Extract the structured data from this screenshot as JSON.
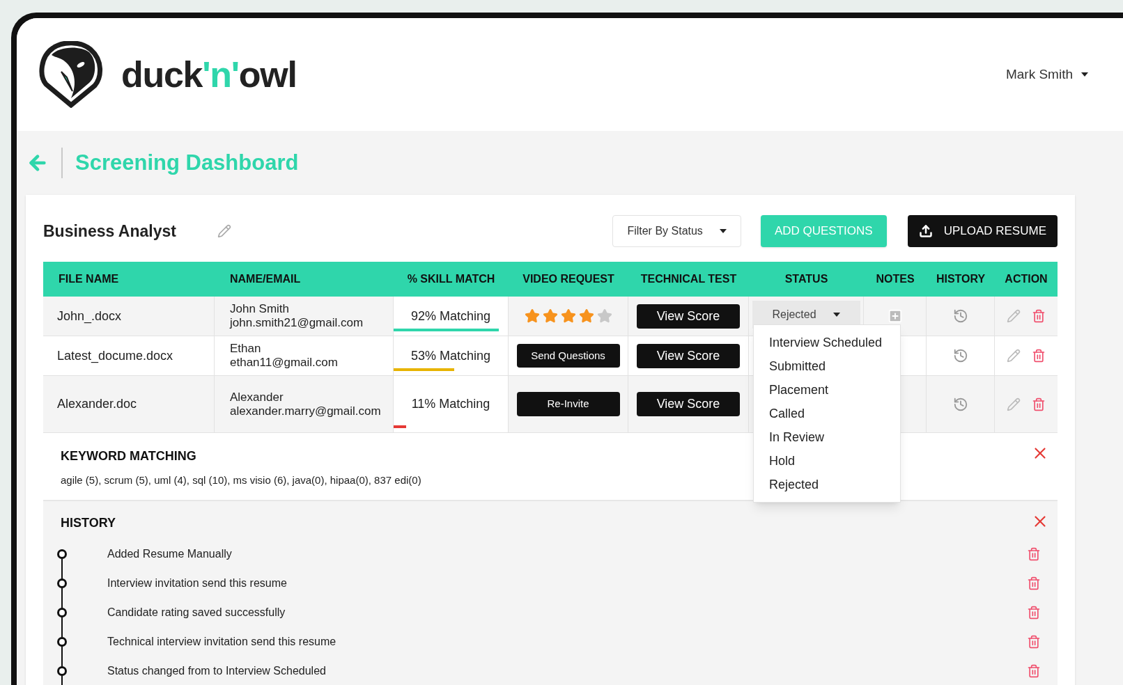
{
  "brand": {
    "parts": [
      {
        "text": "duck",
        "accent": false
      },
      {
        "text": "'n'",
        "accent": true
      },
      {
        "text": "owl",
        "accent": false
      }
    ]
  },
  "user": {
    "name": "Mark Smith"
  },
  "page_title": "Screening Dashboard",
  "job": {
    "title": "Business Analyst",
    "filter": "Filter By Status",
    "add_button": "ADD QUESTIONS",
    "upload_button": "UPLOAD RESUME"
  },
  "table": {
    "columns": [
      "FILE NAME",
      "NAME/EMAIL",
      "% SKILL MATCH",
      "VIDEO REQUEST",
      "TECHNICAL TEST",
      "STATUS",
      "NOTES",
      "HISTORY",
      "ACTION"
    ],
    "rows": [
      {
        "file": "John_.docx",
        "name": "John Smith",
        "email": "john.smith21@gmail.com",
        "match": "92% Matching",
        "level": 0.92,
        "color": "#2fd6ab",
        "video": {
          "kind": "stars",
          "stars": 4
        },
        "test": "View Score",
        "status": "Rejected",
        "notes": true
      },
      {
        "file": "Latest_docume.docx",
        "name": "Ethan",
        "email": "ethan11@gmail.com",
        "match": "53% Matching",
        "level": 0.53,
        "color": "#e8b400",
        "video": {
          "kind": "button",
          "label": "Send Questions"
        },
        "test": "View Score"
      },
      {
        "file": "Alexander.doc",
        "name": "Alexander",
        "email": "alexander.marry@gmail.com",
        "match": "11% Matching",
        "level": 0.11,
        "color": "#e53935",
        "video": {
          "kind": "button",
          "label": "Re-Invite"
        },
        "test": "View Score"
      }
    ]
  },
  "status_menu": [
    "Interview Scheduled",
    "Submitted",
    "Placement",
    "Called",
    "In Review",
    "Hold",
    "Rejected"
  ],
  "keyword_matching": {
    "title": "KEYWORD MATCHING",
    "text": "agile (5), scrum (5), uml (4), sql (10), ms visio (6), java(0), hipaa(0), 837 edi(0)"
  },
  "history": {
    "title": "HISTORY",
    "items": [
      "Added Resume Manually",
      "Interview invitation send this resume",
      "Candidate rating saved successfully",
      "Technical interview invitation send this resume",
      "Status changed from to Interview Scheduled"
    ]
  }
}
